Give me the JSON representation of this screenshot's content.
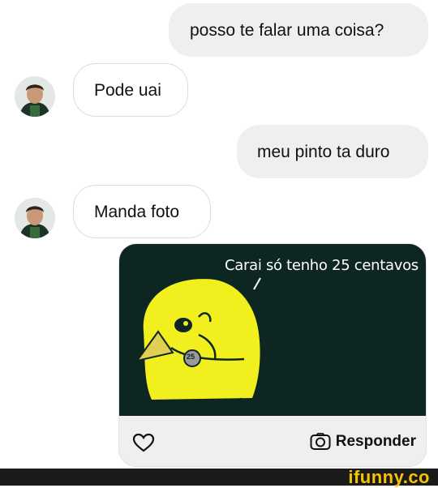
{
  "messages": [
    {
      "from": "me",
      "text": "posso te falar uma coisa?"
    },
    {
      "from": "them",
      "text": "Pode uai"
    },
    {
      "from": "me",
      "text": "meu pinto ta duro"
    },
    {
      "from": "them",
      "text": "Manda foto"
    }
  ],
  "story_reply": {
    "caption": "Carai só tenho 25 centavos",
    "coin_label": "25",
    "reply_label": "Responder"
  },
  "watermark": "ifunny.co",
  "colors": {
    "outgoing_bubble": "#efefef",
    "story_bg": "#0e2622",
    "chick_yellow": "#f2ef1f",
    "watermark": "#f6c400"
  },
  "icons": [
    "heart-icon",
    "camera-icon",
    "avatar"
  ]
}
